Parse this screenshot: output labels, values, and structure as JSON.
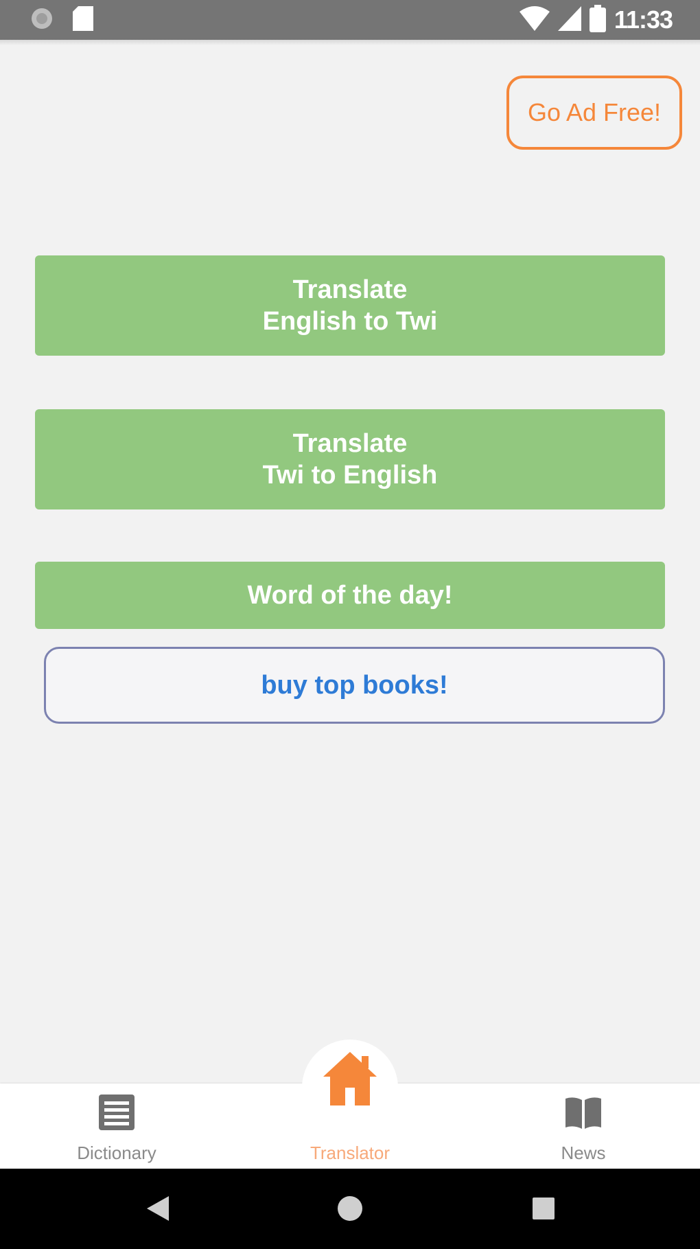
{
  "status_bar": {
    "time": "11:33",
    "icons": [
      "circle-notification-icon",
      "sd-card-icon",
      "wifi-icon",
      "signal-icon",
      "battery-icon"
    ]
  },
  "header": {
    "go_ad_free_label": "Go Ad Free!"
  },
  "actions": {
    "en_to_twi": {
      "line1": "Translate",
      "line2": "English to Twi"
    },
    "twi_to_en": {
      "line1": "Translate",
      "line2": "Twi to English"
    },
    "word_of_day_label": "Word of the day!",
    "buy_books_label": "buy top books!"
  },
  "bottom_nav": {
    "items": [
      {
        "label": "Dictionary",
        "icon": "list-icon",
        "active": false
      },
      {
        "label": "Translator",
        "icon": "home-icon",
        "active": true
      },
      {
        "label": "News",
        "icon": "book-icon",
        "active": false
      }
    ]
  },
  "colors": {
    "accent_orange": "#f5873a",
    "button_green": "#92c87f",
    "link_blue": "#2e7bd6",
    "background": "#f2f2f2"
  }
}
